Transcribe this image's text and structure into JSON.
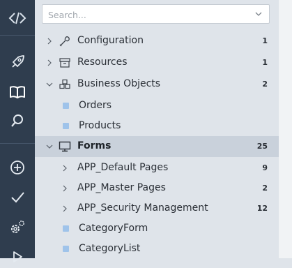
{
  "search": {
    "placeholder": "Search..."
  },
  "rail": {
    "items": [
      "logo-icon",
      "rocket-icon",
      "book-icon",
      "search-icon",
      "add-icon",
      "check-icon",
      "settings-icon",
      "run-icon"
    ]
  },
  "tree": {
    "configuration": {
      "label": "Configuration",
      "count": "1",
      "expanded": false
    },
    "resources": {
      "label": "Resources",
      "count": "1",
      "expanded": false
    },
    "business_objects": {
      "label": "Business Objects",
      "count": "2",
      "expanded": true,
      "children": [
        {
          "label": "Orders"
        },
        {
          "label": "Products"
        }
      ]
    },
    "forms": {
      "label": "Forms",
      "count": "25",
      "expanded": true,
      "selected": true,
      "children": [
        {
          "label": "APP_Default Pages",
          "count": "9"
        },
        {
          "label": "APP_Master Pages",
          "count": "2"
        },
        {
          "label": "APP_Security Management",
          "count": "12"
        },
        {
          "label": "CategoryForm"
        },
        {
          "label": "CategoryList"
        }
      ]
    }
  },
  "colors": {
    "rail_bg": "#2f3d4e",
    "panel_bg": "#dfe4ea",
    "selected_bg": "#c9d1db",
    "leaf_square": "#9fc3ea"
  }
}
